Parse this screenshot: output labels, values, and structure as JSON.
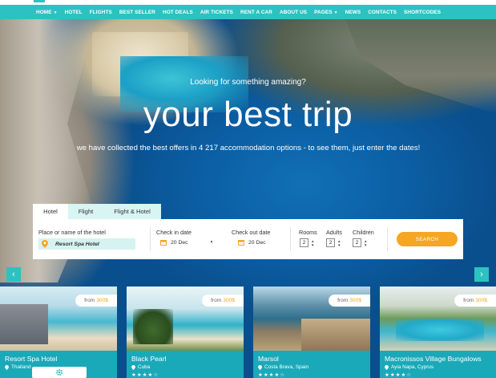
{
  "nav": {
    "items": [
      {
        "label": "HOME",
        "has_dropdown": true
      },
      {
        "label": "HOTEL",
        "has_dropdown": false
      },
      {
        "label": "FLIGHTS",
        "has_dropdown": false
      },
      {
        "label": "BEST SELLER",
        "has_dropdown": false
      },
      {
        "label": "HOT DEALS",
        "has_dropdown": false
      },
      {
        "label": "AIR TICKETS",
        "has_dropdown": false
      },
      {
        "label": "RENT A CAR",
        "has_dropdown": false
      },
      {
        "label": "ABOUT US",
        "has_dropdown": false
      },
      {
        "label": "PAGES",
        "has_dropdown": true
      },
      {
        "label": "NEWS",
        "has_dropdown": false
      },
      {
        "label": "CONTACTS",
        "has_dropdown": false
      },
      {
        "label": "SHORTCODES",
        "has_dropdown": false
      }
    ]
  },
  "hero": {
    "tagline": "Looking for something amazing?",
    "headline": "your best trip",
    "subline": "we have collected the best offers in 4 217 accommodation options - to see them, just enter the dates!"
  },
  "search": {
    "tabs": [
      "Hotel",
      "Flight",
      "Flight & Hotel"
    ],
    "active_tab": "Hotel",
    "hotel_label": "Place or name of the hotel",
    "hotel_value": "Resort Spa Hotel",
    "checkin_label": "Check in date",
    "checkin_value": "20 Dec",
    "checkout_label": "Check out date",
    "checkout_value": "20 Dec",
    "rooms_label": "Rooms",
    "rooms_value": "2",
    "adults_label": "Adults",
    "adults_value": "2",
    "children_label": "Children",
    "children_value": "2",
    "button_label": "SEARCH"
  },
  "slider": {
    "prev_icon": "chevron-left-icon",
    "next_icon": "chevron-right-icon"
  },
  "cards": [
    {
      "price_prefix": "from",
      "price": "300$",
      "name": "Resort Spa Hotel",
      "location": "Thailand",
      "stars": "★★★★★"
    },
    {
      "price_prefix": "from",
      "price": "300$",
      "name": "Black Pearl",
      "location": "Cuba",
      "stars": "★★★★☆"
    },
    {
      "price_prefix": "from",
      "price": "300$",
      "name": "Marsol",
      "location": "Costa Brava, Spain",
      "stars": "★★★★☆"
    },
    {
      "price_prefix": "from",
      "price": "300$",
      "name": "Macronissos Village Bungalows",
      "location": "Ayia Napa, Cyprus",
      "stars": "★★★★☆"
    }
  ],
  "colors": {
    "accent": "#2cc2c1",
    "button": "#f5a623",
    "card_footer": "#1aa9b8"
  }
}
